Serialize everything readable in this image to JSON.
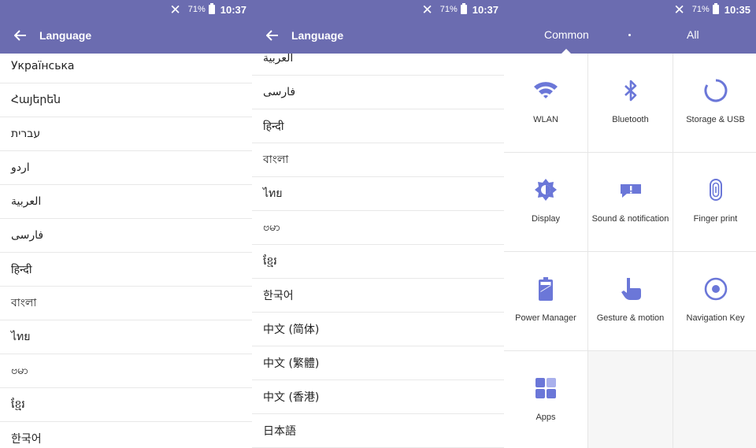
{
  "status": [
    {
      "battery_percent": "71%",
      "time": "10:37"
    },
    {
      "battery_percent": "71%",
      "time": "10:37"
    },
    {
      "battery_percent": "71%",
      "time": "10:35"
    }
  ],
  "language_screen_1": {
    "title": "Language",
    "languages": [
      "Українська",
      "Հայերեն",
      "עברית",
      "اردو",
      "العربية",
      "فارسی",
      "हिन्दी",
      "বাংলা",
      "ไทย",
      "ဗမာ",
      "ខ្មែរ",
      "한국어"
    ]
  },
  "language_screen_2": {
    "title": "Language",
    "languages": [
      "العربية",
      "فارسی",
      "हिन्दी",
      "বাংলা",
      "ไทย",
      "ဗမာ",
      "ខ្មែរ",
      "한국어",
      "中文 (简体)",
      "中文 (繁體)",
      "中文 (香港)",
      "日本語"
    ]
  },
  "settings_screen": {
    "tabs": [
      "Common",
      "All"
    ],
    "active_tab": "Common",
    "accent_color": "#6b6cb0",
    "icon_color": "#6b77d8",
    "items": [
      {
        "label": "WLAN",
        "icon": "wifi-icon"
      },
      {
        "label": "Bluetooth",
        "icon": "bluetooth-icon"
      },
      {
        "label": "Storage & USB",
        "icon": "storage-icon"
      },
      {
        "label": "Display",
        "icon": "display-icon"
      },
      {
        "label": "Sound & notification",
        "icon": "notification-icon"
      },
      {
        "label": "Finger print",
        "icon": "fingerprint-icon"
      },
      {
        "label": "Power Manager",
        "icon": "battery-icon"
      },
      {
        "label": "Gesture & motion",
        "icon": "gesture-icon"
      },
      {
        "label": "Navigation Key",
        "icon": "navigation-key-icon"
      },
      {
        "label": "Apps",
        "icon": "apps-icon"
      }
    ]
  }
}
